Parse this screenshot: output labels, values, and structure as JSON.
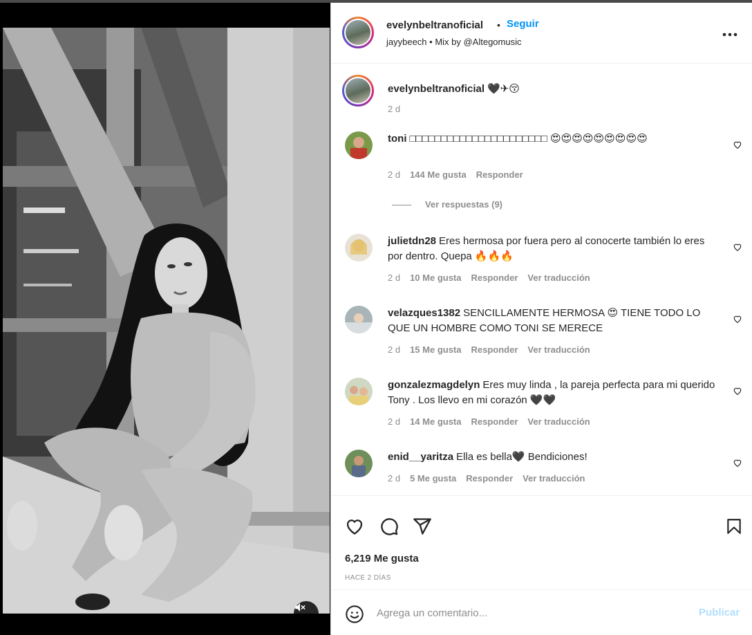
{
  "post": {
    "username": "evelynbeltranoficial",
    "follow_label": "Seguir",
    "dot": "•",
    "audio": "jayybeech • Mix by @Altegomusic",
    "caption_user": "evelynbeltranoficial",
    "caption_text": "🖤✈😚",
    "caption_time": "2 d"
  },
  "comments": [
    {
      "user": "toni",
      "text": "□□□□□□□□□□□□□□□□□□□□□□ 😍😍😍😍😍😍😍😍😍",
      "time": "2 d",
      "likes": "144 Me gusta",
      "reply": "Responder",
      "view_replies": "Ver respuestas (9)"
    },
    {
      "user": "julietdn28",
      "text": "Eres hermosa por fuera pero al conocerte también lo eres por dentro. Quepa 🔥🔥🔥",
      "time": "2 d",
      "likes": "10 Me gusta",
      "reply": "Responder",
      "translate": "Ver traducción"
    },
    {
      "user": "velazques1382",
      "text": "SENCILLAMENTE HERMOSA 😍 TIENE TODO LO QUE UN HOMBRE COMO TONI SE MERECE",
      "time": "2 d",
      "likes": "15 Me gusta",
      "reply": "Responder",
      "translate": "Ver traducción"
    },
    {
      "user": "gonzalezmagdelyn",
      "text": "Eres muy linda , la pareja perfecta para mi querido Tony . Los llevo en mi corazón 🖤🖤",
      "time": "2 d",
      "likes": "14 Me gusta",
      "reply": "Responder",
      "translate": "Ver traducción"
    },
    {
      "user": "enid__yaritza",
      "text": "Ella es bella🖤 Bendiciones!",
      "time": "2 d",
      "likes": "5 Me gusta",
      "reply": "Responder",
      "translate": "Ver traducción"
    }
  ],
  "footer": {
    "likes": "6,219 Me gusta",
    "time": "HACE 2 DÍAS",
    "comment_placeholder": "Agrega un comentario...",
    "publish_label": "Publicar"
  },
  "colors": {
    "accent": "#0095f6",
    "publish_disabled": "#b2dffc",
    "meta_gray": "#8e8e8e"
  }
}
